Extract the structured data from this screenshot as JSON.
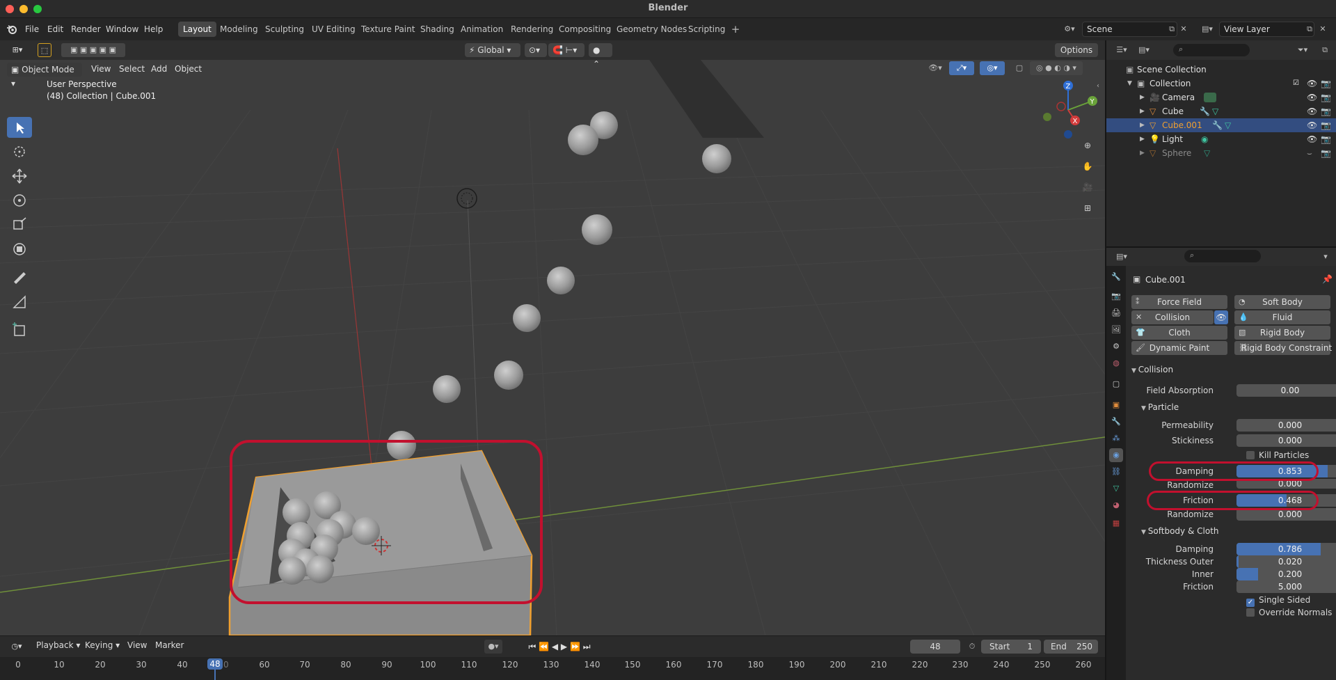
{
  "app": {
    "title": "Blender"
  },
  "menu": [
    "File",
    "Edit",
    "Render",
    "Window",
    "Help"
  ],
  "workspaces": [
    "Layout",
    "Modeling",
    "Sculpting",
    "UV Editing",
    "Texture Paint",
    "Shading",
    "Animation",
    "Rendering",
    "Compositing",
    "Geometry Nodes",
    "Scripting"
  ],
  "active_workspace": "Layout",
  "scene": {
    "name": "Scene",
    "view_layer": "View Layer"
  },
  "viewport": {
    "transform_orientation": "Global",
    "options_label": "Options",
    "mode": "Object Mode",
    "menus": [
      "View",
      "Select",
      "Add",
      "Object"
    ],
    "info_line1": "User Perspective",
    "info_line2": "(48) Collection | Cube.001",
    "gizmo_axes": {
      "x": "X",
      "y": "Y",
      "z": "Z"
    }
  },
  "timeline": {
    "menus": [
      "Playback",
      "Keying",
      "View",
      "Marker"
    ],
    "current_frame": "48",
    "start_label": "Start",
    "start": "1",
    "end_label": "End",
    "end": "250",
    "ticks": [
      "0",
      "10",
      "20",
      "30",
      "40",
      "50",
      "60",
      "70",
      "80",
      "90",
      "100",
      "110",
      "120",
      "130",
      "140",
      "150",
      "160",
      "170",
      "180",
      "190",
      "200",
      "210",
      "220",
      "230",
      "240",
      "250",
      "260"
    ],
    "playhead_label": "48"
  },
  "outliner": {
    "root": "Scene Collection",
    "collection": "Collection",
    "items": [
      "Camera",
      "Cube",
      "Cube.001",
      "Light",
      "Sphere"
    ]
  },
  "properties": {
    "object_name": "Cube.001",
    "physics_buttons": {
      "force_field": "Force Field",
      "soft_body": "Soft Body",
      "collision": "Collision",
      "fluid": "Fluid",
      "cloth": "Cloth",
      "rigid_body": "Rigid Body",
      "dynamic_paint": "Dynamic Paint",
      "rigid_body_constraint": "Rigid Body Constraint"
    },
    "collision_section": "Collision",
    "field_absorption_label": "Field Absorption",
    "field_absorption": "0.00",
    "particle_section": "Particle",
    "permeability_label": "Permeability",
    "permeability": "0.000",
    "stickiness_label": "Stickiness",
    "stickiness": "0.000",
    "kill_particles_label": "Kill Particles",
    "damping_label": "Damping",
    "damping": "0.853",
    "damping_fraction": 0.853,
    "randomize_label": "Randomize",
    "randomize1": "0.000",
    "friction_label": "Friction",
    "friction": "0.468",
    "friction_fraction": 0.468,
    "randomize2": "0.000",
    "softbody_section": "Softbody & Cloth",
    "sb_damping_label": "Damping",
    "sb_damping": "0.786",
    "sb_damping_fraction": 0.786,
    "thickness_outer_label": "Thickness Outer",
    "thickness_outer": "0.020",
    "thickness_outer_fraction": 0.02,
    "inner_label": "Inner",
    "inner": "0.200",
    "inner_fraction": 0.2,
    "sb_friction_label": "Friction",
    "sb_friction": "5.000",
    "single_sided_label": "Single Sided",
    "override_normals_label": "Override Normals"
  },
  "colors": {
    "accent": "#4772b3",
    "selection_outline": "#f0a030",
    "annotation": "#c2102e"
  }
}
